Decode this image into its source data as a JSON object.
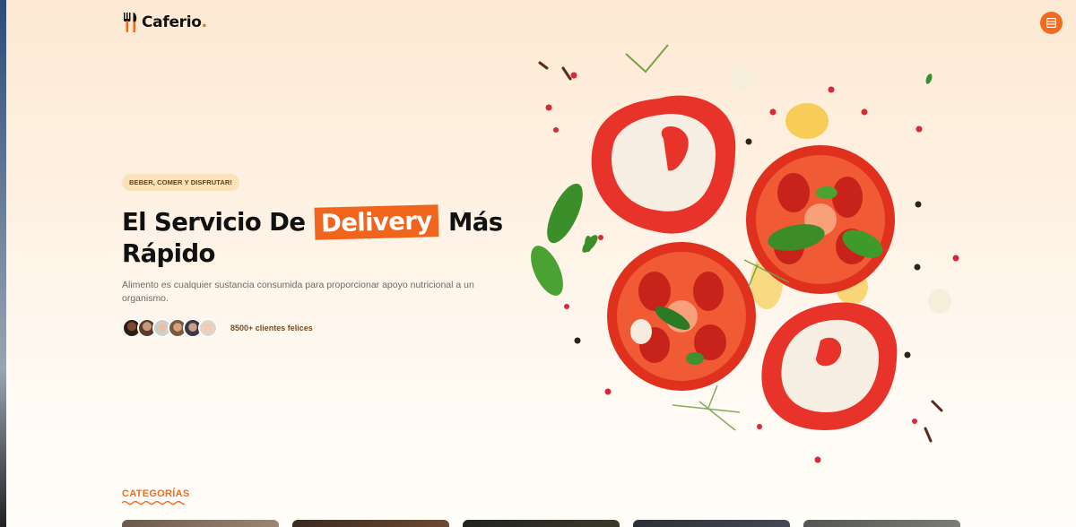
{
  "brand": {
    "name": "Caferio",
    "dot": ".",
    "accent": "#f26a1b"
  },
  "nav": {
    "menu_icon": "menu-icon"
  },
  "hero": {
    "badge": "BEBER, COMER Y DISFRUTAR!",
    "title_part1": "El Servicio De",
    "title_highlight": "Delivery",
    "title_part2": "Más",
    "title_line2": "Rápido",
    "description": "Alimento es cualquier sustancia consumida para proporcionar apoyo nutricional a un organismo.",
    "clients_text": "8500+ clientes felices",
    "avatar_count": 6
  },
  "categories": {
    "label": "CATEGORÍAS",
    "card_count": 5
  }
}
